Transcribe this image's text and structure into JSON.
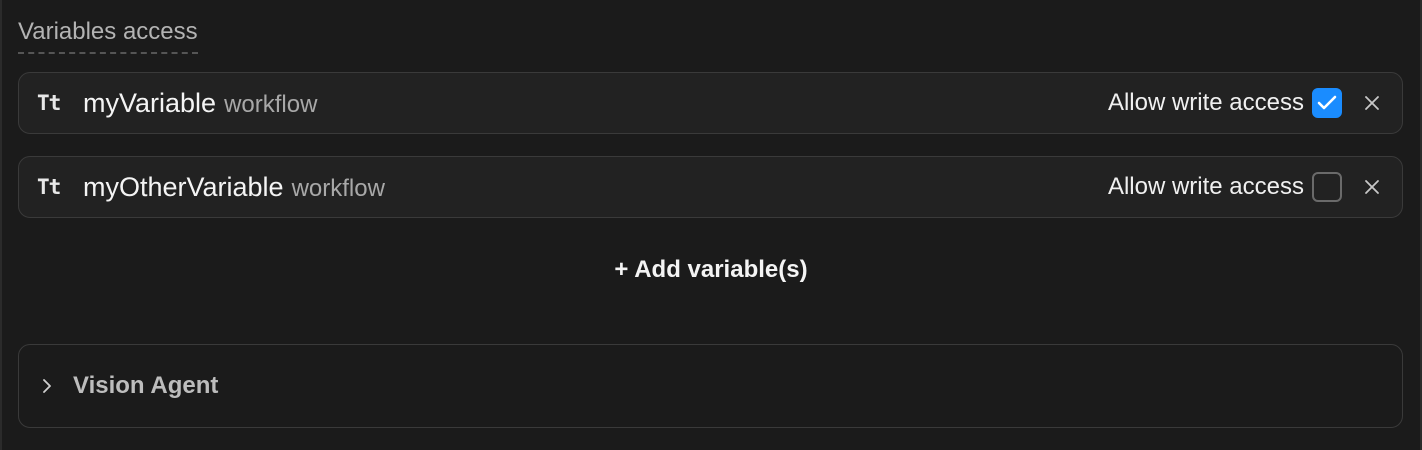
{
  "section": {
    "title": "Variables access"
  },
  "variables": [
    {
      "type_icon": "Tt",
      "name": "myVariable",
      "scope": "workflow",
      "allow_label": "Allow write access",
      "write_access": true
    },
    {
      "type_icon": "Tt",
      "name": "myOtherVariable",
      "scope": "workflow",
      "allow_label": "Allow write access",
      "write_access": false
    }
  ],
  "add_button": {
    "label": "+ Add variable(s)"
  },
  "accordion": {
    "label": "Vision Agent",
    "expanded": false
  },
  "colors": {
    "accent": "#1a8cff",
    "background": "#1b1b1b",
    "row_bg": "#222222",
    "border": "#3a3a3a"
  },
  "icons": {
    "remove": "close-icon",
    "checkmark": "check-icon",
    "chevron": "chevron-right-icon"
  }
}
